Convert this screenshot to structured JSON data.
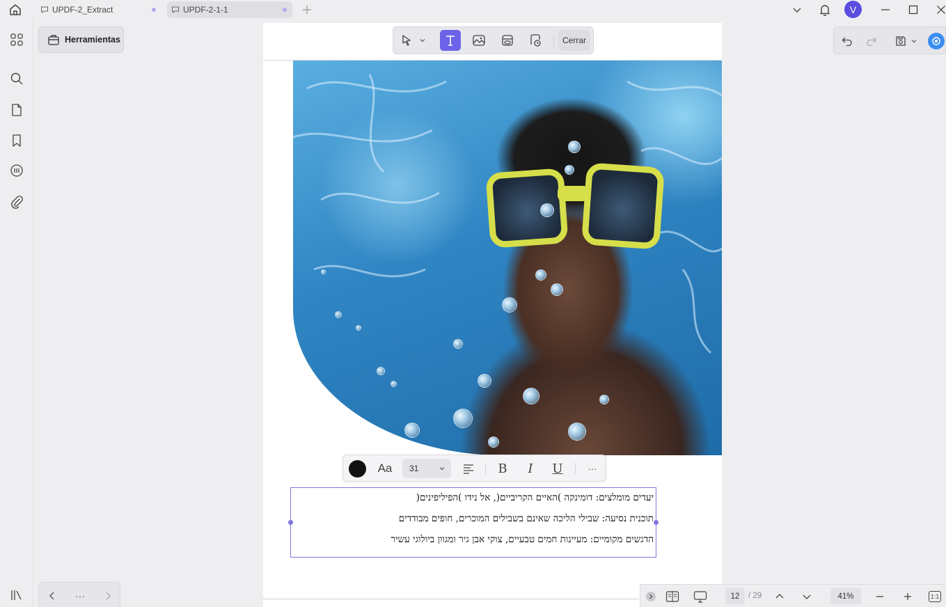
{
  "titlebar": {
    "tabs": [
      {
        "label": "UPDF-2_Extract",
        "active": false
      },
      {
        "label": "UPDF-2-1-1",
        "active": true
      }
    ],
    "avatar_letter": "V",
    "accent_color": "#5b4de0"
  },
  "rail": {
    "items": [
      "apps-icon",
      "search-icon",
      "pages-icon",
      "bookmark-icon",
      "comments-icon",
      "attachment-icon"
    ],
    "bottom_item": "panel-toggle-icon"
  },
  "tools_panel": {
    "tools_label": "Herramientas"
  },
  "edit_toolbar": {
    "close_label": "Cerrar",
    "tools": [
      "select-pointer-icon",
      "dropdown-chevron-icon",
      "edit-text-icon",
      "edit-image-icon",
      "edit-link-icon",
      "edit-stamp-icon"
    ],
    "active_tool": "edit-text-icon"
  },
  "format_toolbar": {
    "font_label": "Aa",
    "font_size": "31",
    "text_color": "#000000",
    "bold": "B",
    "italic": "I",
    "underline": "U",
    "more": "···"
  },
  "text_box": {
    "lines": [
      "יעדים מומלצים: דומינקה )האיים הקריביים(, אל נידו )הפיליפינים(",
      "תוכנית נסיעה: שבילי הליכה שאינם בשבילים המוכרים, חופים מבודדים",
      "הדגשים מקומיים: מעיינות חמים טבעיים, צוקי אבן גיר ומגוון ביולוגי עשיר"
    ]
  },
  "page_nav": {
    "prev": "‹",
    "more": "···",
    "next": "›"
  },
  "status_bar": {
    "current_page": "12",
    "total_pages": "/ 29",
    "zoom": "41%",
    "fit_label": "1:1"
  }
}
